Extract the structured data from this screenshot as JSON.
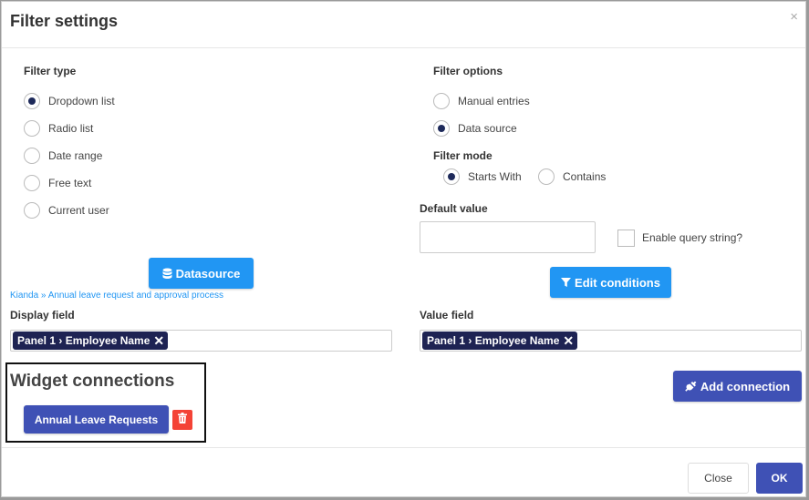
{
  "dialog": {
    "title": "Filter settings",
    "close_glyph": "×"
  },
  "filter_type": {
    "label": "Filter type",
    "options": [
      "Dropdown list",
      "Radio list",
      "Date range",
      "Free text",
      "Current user"
    ],
    "selected": "Dropdown list"
  },
  "filter_options": {
    "label": "Filter options",
    "options": [
      "Manual entries",
      "Data source"
    ],
    "selected": "Data source"
  },
  "filter_mode": {
    "label": "Filter mode",
    "options": [
      "Starts With",
      "Contains"
    ],
    "selected": "Starts With"
  },
  "default_value": {
    "label": "Default value",
    "value": ""
  },
  "query_string": {
    "label": "Enable query string?",
    "checked": false
  },
  "datasource_button": {
    "label": "Datasource",
    "icon": "database-icon"
  },
  "edit_conditions_button": {
    "label": "Edit conditions",
    "icon": "filter-icon"
  },
  "breadcrumb": "Kianda » Annual leave request and approval process",
  "display_field": {
    "label": "Display field",
    "tag": "Panel 1 › Employee Name",
    "remove_glyph": "✕"
  },
  "value_field": {
    "label": "Value field",
    "tag": "Panel 1 › Employee Name",
    "remove_glyph": "✕"
  },
  "widget_connections": {
    "title": "Widget connections",
    "connection_label": "Annual Leave Requests",
    "add_label": "Add connection",
    "add_icon": "plug-icon",
    "delete_icon": "trash-icon"
  },
  "footer": {
    "close_label": "Close",
    "ok_label": "OK"
  },
  "colors": {
    "primary": "#2196f3",
    "indigo": "#3f51b5",
    "tag": "#1e2353",
    "danger": "#f44336"
  }
}
